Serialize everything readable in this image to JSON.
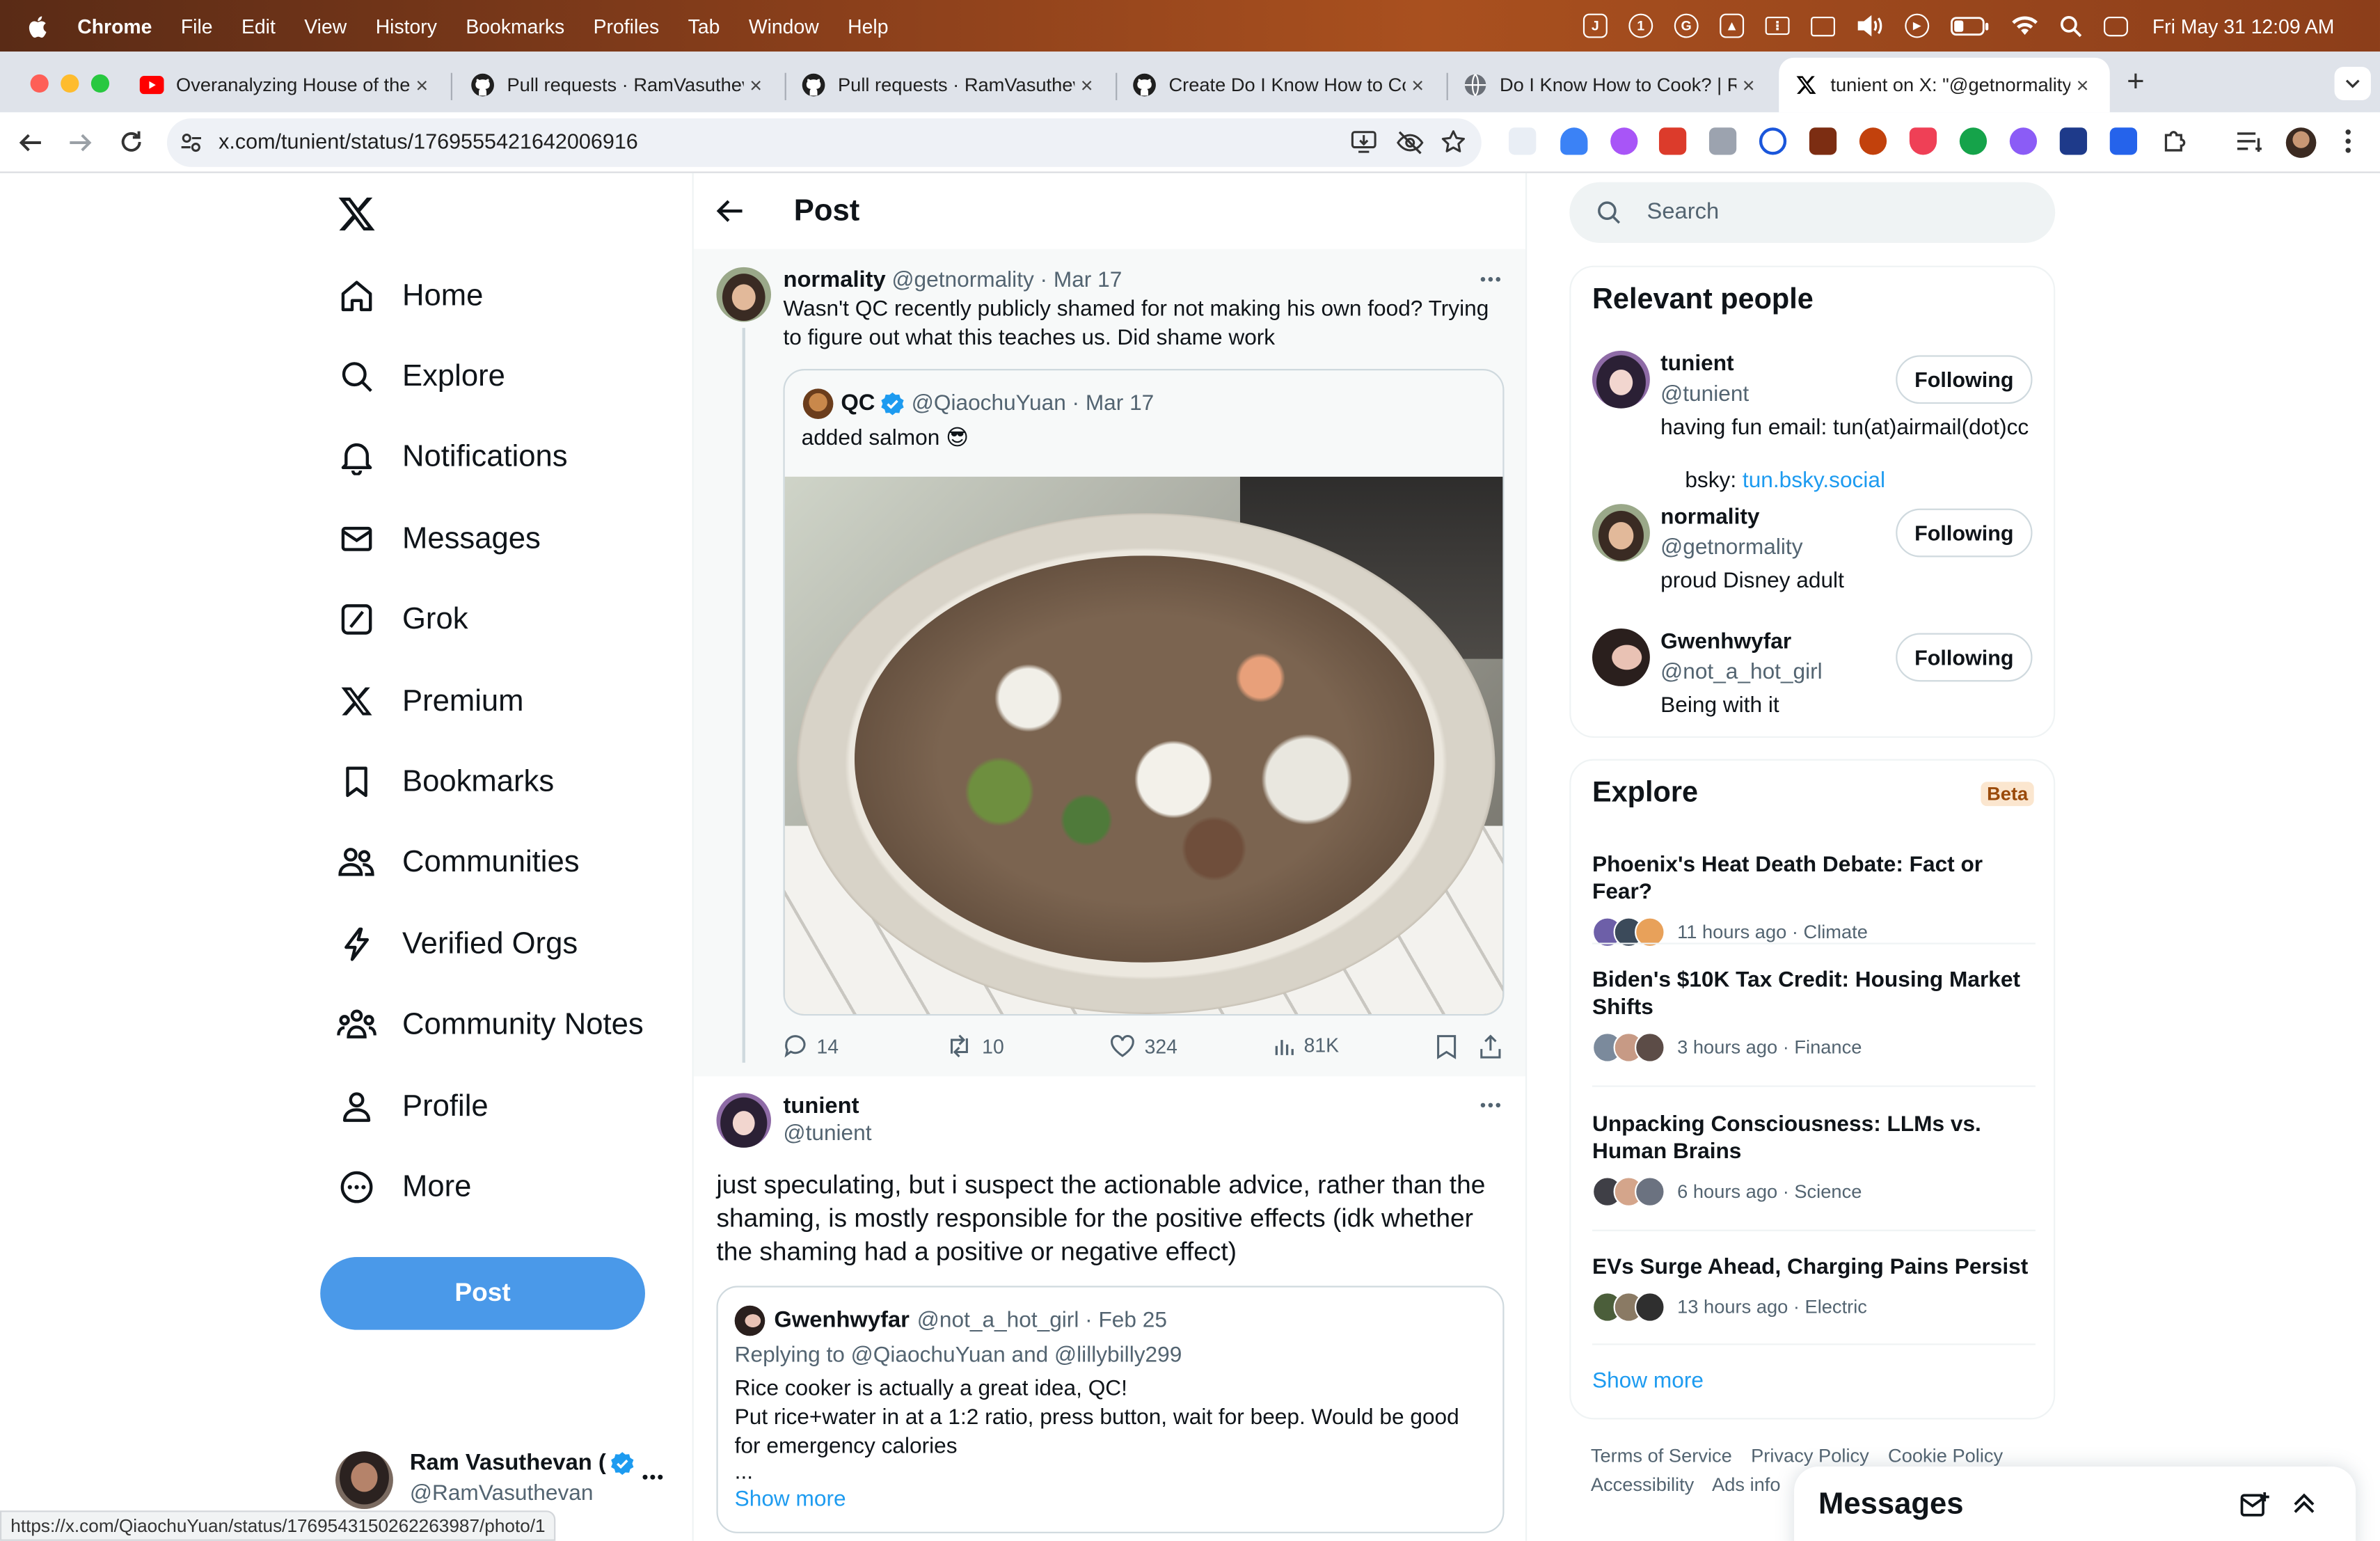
{
  "menubar": {
    "apple": "",
    "app": "Chrome",
    "items": [
      "File",
      "Edit",
      "View",
      "History",
      "Bookmarks",
      "Profiles",
      "Tab",
      "Window",
      "Help"
    ],
    "clock": "Fri May 31  12:09 AM"
  },
  "tabs": [
    {
      "title": "Overanalyzing House of the D",
      "icon": "youtube-icon"
    },
    {
      "title": "Pull requests · RamVasutheva",
      "icon": "github-icon"
    },
    {
      "title": "Pull requests · RamVasutheva",
      "icon": "github-icon"
    },
    {
      "title": "Create Do I Know How to Coo",
      "icon": "github-icon"
    },
    {
      "title": "Do I Know How to Cook? | Ra",
      "icon": "globe-icon"
    },
    {
      "title": "tunient on X: \"@getnormality",
      "icon": "x-icon"
    }
  ],
  "address": {
    "url": "x.com/tunient/status/1769555421642006916"
  },
  "nav": {
    "items": [
      "Home",
      "Explore",
      "Notifications",
      "Messages",
      "Grok",
      "Premium",
      "Bookmarks",
      "Communities",
      "Verified Orgs",
      "Community Notes",
      "Profile",
      "More"
    ],
    "post_button": "Post"
  },
  "account": {
    "name": "Ram Vasuthevan (",
    "handle": "@RamVasuthevan"
  },
  "header": {
    "title": "Post"
  },
  "parent_tweet": {
    "name": "normality",
    "handle": "@getnormality",
    "date": "· Mar 17",
    "text": "Wasn't QC recently publicly shamed for not making his own food? Trying to figure out what this teaches us. Did shame work",
    "quote": {
      "name": "QC",
      "handle": "@QiaochuYuan",
      "date": "· Mar 17",
      "text": "added salmon 😎"
    },
    "stats": {
      "replies": "14",
      "retweets": "10",
      "likes": "324",
      "views": "81K"
    }
  },
  "main_tweet": {
    "name": "tunient",
    "handle": "@tunient",
    "text": "just speculating, but i suspect the actionable advice, rather than the shaming, is mostly responsible for the positive effects (idk whether the shaming had a positive or negative effect)",
    "quote": {
      "name": "Gwenhwyfar",
      "handle": "@not_a_hot_girl",
      "date": "· Feb 25",
      "replying": "Replying to @QiaochuYuan and @lillybilly299",
      "line1": "Rice cooker is actually a great idea, QC!",
      "line2": "Put rice+water in at a 1:2 ratio, press button, wait for beep. Would be good for emergency calories",
      "line3": "...",
      "show_more": "Show more"
    }
  },
  "search": {
    "placeholder": "Search"
  },
  "relevant": {
    "title": "Relevant people",
    "people": [
      {
        "name": "tunient",
        "handle": "@tunient",
        "bio": "having fun email: tun(at)airmail(dot)cc",
        "bio2": "bsky: ",
        "bio_link": "tun.bsky.social",
        "button": "Following"
      },
      {
        "name": "normality",
        "handle": "@getnormality",
        "bio": "proud Disney adult",
        "button": "Following"
      },
      {
        "name": "Gwenhwyfar",
        "handle": "@not_a_hot_girl",
        "bio": "Being with it",
        "button": "Following"
      }
    ]
  },
  "explore": {
    "title": "Explore",
    "badge": "Beta",
    "trends": [
      {
        "title": "Phoenix's Heat Death Debate: Fact or Fear?",
        "meta": "11 hours ago · Climate"
      },
      {
        "title": "Biden's $10K Tax Credit: Housing Market Shifts",
        "meta": "3 hours ago · Finance"
      },
      {
        "title": "Unpacking Consciousness: LLMs vs. Human Brains",
        "meta": "6 hours ago · Science"
      },
      {
        "title": "EVs Surge Ahead, Charging Pains Persist",
        "meta": "13 hours ago · Electric"
      }
    ],
    "show_more": "Show more"
  },
  "footer": {
    "links": [
      "Terms of Service",
      "Privacy Policy",
      "Cookie Policy",
      "Accessibility",
      "Ads info"
    ]
  },
  "messages_drawer": {
    "title": "Messages"
  },
  "status_url": "https://x.com/QiaochuYuan/status/1769543150262263987/photo/1",
  "colors": {
    "accent": "#1d9bf0",
    "post_button": "#4a99e9",
    "text": "#0f1419",
    "muted": "#536471"
  }
}
